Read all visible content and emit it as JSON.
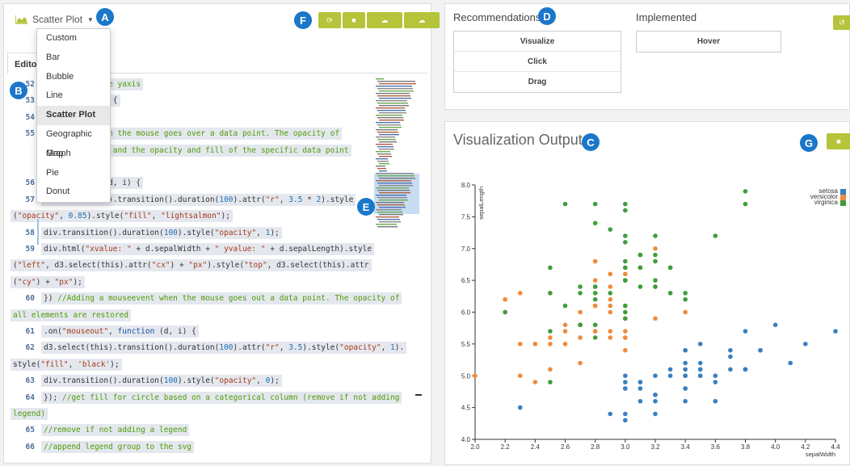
{
  "left": {
    "chart_type_selected": "Scatter Plot",
    "menu_items": [
      "Custom",
      "Bar",
      "Bubble",
      "Line",
      "Scatter Plot",
      "Geographic Map",
      "Graph",
      "Pie",
      "Donut"
    ],
    "active_menu_index": 4,
    "tab_label": "Edito",
    "toolbar_icons": [
      "refresh-icon",
      "save-icon",
      "cloud-upload-icon",
      "cloud-download-icon"
    ]
  },
  "badges": {
    "a": "A",
    "b": "B",
    "c": "C",
    "d": "D",
    "e": "E",
    "f": "F",
    "g": "G"
  },
  "code_lines": [
    {
      "n": "52",
      "parts": [
        {
          "t": "     position on the yaxis",
          "c": "cmt"
        }
      ]
    },
    {
      "n": "53",
      "parts": [
        {
          "t": "      , function (d) {",
          "c": ""
        }
      ]
    },
    {
      "n": "54",
      "parts": [
        {
          "t": "      r(d.species);",
          "c": ""
        }
      ]
    },
    {
      "n": "55",
      "parts": [
        {
          "t": "      mouseevent when the mouse goes over a data point. The opacity of",
          "c": "cmt"
        }
      ]
    },
    {
      "n": "",
      "parts": [
        {
          "t": "      nts is reduced and the opacity and fill of the specific data point",
          "c": "cmt"
        }
      ]
    },
    {
      "n": "",
      "parts": [
        {
          "t": "",
          "c": ""
        }
      ]
    },
    {
      "n": "56",
      "parts": [
        {
          "t": "      r\", function (d, i) {",
          "c": ""
        }
      ]
    },
    {
      "n": "57",
      "parts": [
        {
          "t": "  d3.select(this).transition().duration(",
          "c": ""
        },
        {
          "t": "100",
          "c": "num"
        },
        {
          "t": ").attr(",
          "c": ""
        },
        {
          "t": "\"r\"",
          "c": "str"
        },
        {
          "t": ", ",
          "c": ""
        },
        {
          "t": "3.5",
          "c": "num"
        },
        {
          "t": " * ",
          "c": ""
        },
        {
          "t": "2",
          "c": "num"
        },
        {
          "t": ").style",
          "c": ""
        }
      ]
    },
    {
      "n": "",
      "wrap": true,
      "parts": [
        {
          "t": "(",
          "c": ""
        },
        {
          "t": "\"opacity\"",
          "c": "str"
        },
        {
          "t": ", ",
          "c": ""
        },
        {
          "t": "0.85",
          "c": "num"
        },
        {
          "t": ").style(",
          "c": ""
        },
        {
          "t": "\"fill\"",
          "c": "str"
        },
        {
          "t": ", ",
          "c": ""
        },
        {
          "t": "\"lightsalmon\"",
          "c": "str"
        },
        {
          "t": ");",
          "c": ""
        }
      ]
    },
    {
      "n": "58",
      "parts": [
        {
          "t": "    div.transition().duration(",
          "c": ""
        },
        {
          "t": "100",
          "c": "num"
        },
        {
          "t": ").style(",
          "c": ""
        },
        {
          "t": "\"opacity\"",
          "c": "str"
        },
        {
          "t": ", ",
          "c": ""
        },
        {
          "t": "1",
          "c": "num"
        },
        {
          "t": ");",
          "c": ""
        }
      ]
    },
    {
      "n": "59",
      "parts": [
        {
          "t": "    div.html(",
          "c": ""
        },
        {
          "t": "\"xvalue: \"",
          "c": "str"
        },
        {
          "t": " + d.sepalWidth + ",
          "c": ""
        },
        {
          "t": "\" yvalue: \"",
          "c": "str"
        },
        {
          "t": " + d.sepalLength).style",
          "c": ""
        }
      ]
    },
    {
      "n": "",
      "wrap": true,
      "parts": [
        {
          "t": "(",
          "c": ""
        },
        {
          "t": "\"left\"",
          "c": "str"
        },
        {
          "t": ", d3.select(this).attr(",
          "c": ""
        },
        {
          "t": "\"cx\"",
          "c": "str"
        },
        {
          "t": ") + ",
          "c": ""
        },
        {
          "t": "\"px\"",
          "c": "str"
        },
        {
          "t": ").style(",
          "c": ""
        },
        {
          "t": "\"top\"",
          "c": "str"
        },
        {
          "t": ", d3.select(this).attr",
          "c": ""
        }
      ]
    },
    {
      "n": "",
      "wrap": true,
      "parts": [
        {
          "t": "(",
          "c": ""
        },
        {
          "t": "\"cy\"",
          "c": "str"
        },
        {
          "t": ") + ",
          "c": ""
        },
        {
          "t": "\"px\"",
          "c": "str"
        },
        {
          "t": ");",
          "c": ""
        }
      ]
    },
    {
      "n": "60",
      "parts": [
        {
          "t": "  }) ",
          "c": ""
        },
        {
          "t": "//Adding a mouseevent when the mouse goes out a data point. The opacity of",
          "c": "cmt"
        }
      ]
    },
    {
      "n": "",
      "wrap": true,
      "parts": [
        {
          "t": "all elements are restored",
          "c": "cmt"
        }
      ]
    },
    {
      "n": "61",
      "parts": [
        {
          "t": "  .on(",
          "c": ""
        },
        {
          "t": "\"mouseout\"",
          "c": "str"
        },
        {
          "t": ", ",
          "c": ""
        },
        {
          "t": "function",
          "c": "kw"
        },
        {
          "t": " (d, i) {",
          "c": ""
        }
      ]
    },
    {
      "n": "62",
      "parts": [
        {
          "t": "    d3.select(this).transition().duration(",
          "c": ""
        },
        {
          "t": "100",
          "c": "num"
        },
        {
          "t": ").attr(",
          "c": ""
        },
        {
          "t": "\"r\"",
          "c": "str"
        },
        {
          "t": ", ",
          "c": ""
        },
        {
          "t": "3.5",
          "c": "num"
        },
        {
          "t": ").style(",
          "c": ""
        },
        {
          "t": "\"opacity\"",
          "c": "str"
        },
        {
          "t": ", ",
          "c": ""
        },
        {
          "t": "1",
          "c": "num"
        },
        {
          "t": ").",
          "c": ""
        }
      ]
    },
    {
      "n": "",
      "wrap": true,
      "parts": [
        {
          "t": "style(",
          "c": ""
        },
        {
          "t": "\"fill\"",
          "c": "str"
        },
        {
          "t": ", ",
          "c": ""
        },
        {
          "t": "'black'",
          "c": "str"
        },
        {
          "t": ");",
          "c": ""
        }
      ]
    },
    {
      "n": "63",
      "parts": [
        {
          "t": "    div.transition().duration(",
          "c": ""
        },
        {
          "t": "100",
          "c": "num"
        },
        {
          "t": ").style(",
          "c": ""
        },
        {
          "t": "\"opacity\"",
          "c": "str"
        },
        {
          "t": ", ",
          "c": ""
        },
        {
          "t": "0",
          "c": "num"
        },
        {
          "t": ");",
          "c": ""
        }
      ]
    },
    {
      "n": "64",
      "parts": [
        {
          "t": "  }); ",
          "c": ""
        },
        {
          "t": "//get fill for circle based on a categorical column (remove if not adding",
          "c": "cmt"
        }
      ]
    },
    {
      "n": "",
      "wrap": true,
      "parts": [
        {
          "t": "legend)",
          "c": "cmt"
        }
      ]
    },
    {
      "n": "65",
      "parts": [
        {
          "t": "  //remove if not adding a legend",
          "c": "cmt"
        }
      ]
    },
    {
      "n": "66",
      "parts": [
        {
          "t": "  //append legend group to the svg",
          "c": "cmt"
        }
      ]
    }
  ],
  "recommendations": {
    "heading": "Recommendations",
    "items": [
      "Visualize",
      "Click",
      "Drag"
    ],
    "implemented_heading": "Implemented",
    "implemented_items": [
      "Hover"
    ]
  },
  "output": {
    "title": "Visualization Output"
  },
  "colors": {
    "accent": "#b5c43a",
    "badge": "#1a77c9",
    "setosa": "#3a7fc1",
    "versicolor": "#f08a3c",
    "virginica": "#3f9e3a"
  },
  "chart_data": {
    "type": "scatter",
    "xlabel": "sepalWidth",
    "ylabel": "sepalLength",
    "xlim": [
      2.0,
      4.4
    ],
    "ylim": [
      4.0,
      8.0
    ],
    "xticks": [
      "2.0",
      "2.2",
      "2.4",
      "2.6",
      "2.8",
      "3.0",
      "3.2",
      "3.4",
      "3.6",
      "3.8",
      "4.0",
      "4.2",
      "4.4"
    ],
    "yticks": [
      "4.0",
      "4.5",
      "5.0",
      "5.5",
      "6.0",
      "6.5",
      "7.0",
      "7.5",
      "8.0"
    ],
    "legend": "top-right",
    "series": [
      {
        "name": "setosa",
        "points": [
          [
            3.5,
            5.1
          ],
          [
            3.0,
            4.9
          ],
          [
            3.2,
            4.7
          ],
          [
            3.1,
            4.6
          ],
          [
            3.6,
            5.0
          ],
          [
            3.9,
            5.4
          ],
          [
            3.4,
            4.6
          ],
          [
            3.4,
            5.0
          ],
          [
            2.9,
            4.4
          ],
          [
            3.1,
            4.9
          ],
          [
            3.7,
            5.4
          ],
          [
            3.4,
            4.8
          ],
          [
            3.0,
            4.8
          ],
          [
            3.0,
            4.3
          ],
          [
            4.0,
            5.8
          ],
          [
            4.4,
            5.7
          ],
          [
            3.9,
            5.4
          ],
          [
            3.5,
            5.1
          ],
          [
            3.8,
            5.7
          ],
          [
            3.8,
            5.1
          ],
          [
            3.4,
            5.4
          ],
          [
            3.7,
            5.1
          ],
          [
            3.6,
            4.6
          ],
          [
            3.3,
            5.1
          ],
          [
            3.4,
            4.8
          ],
          [
            3.0,
            5.0
          ],
          [
            3.4,
            5.0
          ],
          [
            3.5,
            5.2
          ],
          [
            3.4,
            5.2
          ],
          [
            3.2,
            4.7
          ],
          [
            3.1,
            4.8
          ],
          [
            3.4,
            5.4
          ],
          [
            4.1,
            5.2
          ],
          [
            4.2,
            5.5
          ],
          [
            3.1,
            4.9
          ],
          [
            3.2,
            5.0
          ],
          [
            3.5,
            5.5
          ],
          [
            3.6,
            4.9
          ],
          [
            3.0,
            4.4
          ],
          [
            3.4,
            5.1
          ],
          [
            3.5,
            5.0
          ],
          [
            2.3,
            4.5
          ],
          [
            3.2,
            4.4
          ],
          [
            3.5,
            5.0
          ],
          [
            3.8,
            5.1
          ],
          [
            3.0,
            4.8
          ],
          [
            3.8,
            5.1
          ],
          [
            3.2,
            4.6
          ],
          [
            3.7,
            5.3
          ],
          [
            3.3,
            5.0
          ]
        ]
      },
      {
        "name": "versicolor",
        "points": [
          [
            3.2,
            7.0
          ],
          [
            3.2,
            6.4
          ],
          [
            3.1,
            6.9
          ],
          [
            2.3,
            5.5
          ],
          [
            2.8,
            6.5
          ],
          [
            2.8,
            5.7
          ],
          [
            3.3,
            6.3
          ],
          [
            2.4,
            4.9
          ],
          [
            2.9,
            6.6
          ],
          [
            2.7,
            5.2
          ],
          [
            2.0,
            5.0
          ],
          [
            3.0,
            5.9
          ],
          [
            2.2,
            6.0
          ],
          [
            2.9,
            6.1
          ],
          [
            2.9,
            5.6
          ],
          [
            3.1,
            6.7
          ],
          [
            3.0,
            5.6
          ],
          [
            2.7,
            5.8
          ],
          [
            2.2,
            6.2
          ],
          [
            2.5,
            5.6
          ],
          [
            3.2,
            5.9
          ],
          [
            2.8,
            6.1
          ],
          [
            2.5,
            6.3
          ],
          [
            2.8,
            6.1
          ],
          [
            2.9,
            6.4
          ],
          [
            3.0,
            6.6
          ],
          [
            2.8,
            6.8
          ],
          [
            3.0,
            6.7
          ],
          [
            2.9,
            6.0
          ],
          [
            2.6,
            5.7
          ],
          [
            2.4,
            5.5
          ],
          [
            2.4,
            5.5
          ],
          [
            2.7,
            5.8
          ],
          [
            2.7,
            6.0
          ],
          [
            3.0,
            5.4
          ],
          [
            3.4,
            6.0
          ],
          [
            3.1,
            6.7
          ],
          [
            2.3,
            6.3
          ],
          [
            3.0,
            5.6
          ],
          [
            2.5,
            5.5
          ],
          [
            2.6,
            5.5
          ],
          [
            3.0,
            6.1
          ],
          [
            2.6,
            5.8
          ],
          [
            2.3,
            5.0
          ],
          [
            2.7,
            5.6
          ],
          [
            3.0,
            5.7
          ],
          [
            2.9,
            5.7
          ],
          [
            2.9,
            6.2
          ],
          [
            2.5,
            5.1
          ],
          [
            2.8,
            5.7
          ]
        ]
      },
      {
        "name": "virginica",
        "points": [
          [
            3.3,
            6.3
          ],
          [
            2.7,
            5.8
          ],
          [
            3.0,
            7.1
          ],
          [
            2.9,
            6.3
          ],
          [
            3.0,
            6.5
          ],
          [
            3.0,
            7.6
          ],
          [
            2.5,
            4.9
          ],
          [
            2.9,
            7.3
          ],
          [
            2.5,
            6.7
          ],
          [
            3.6,
            7.2
          ],
          [
            3.2,
            6.5
          ],
          [
            2.7,
            6.4
          ],
          [
            3.0,
            6.8
          ],
          [
            2.5,
            5.7
          ],
          [
            2.8,
            5.8
          ],
          [
            3.2,
            6.4
          ],
          [
            3.0,
            6.5
          ],
          [
            3.8,
            7.7
          ],
          [
            2.6,
            7.7
          ],
          [
            2.2,
            6.0
          ],
          [
            3.2,
            6.9
          ],
          [
            2.8,
            5.6
          ],
          [
            2.8,
            7.7
          ],
          [
            2.7,
            6.3
          ],
          [
            3.3,
            6.7
          ],
          [
            3.2,
            7.2
          ],
          [
            2.8,
            6.2
          ],
          [
            3.0,
            6.1
          ],
          [
            2.8,
            6.4
          ],
          [
            3.0,
            7.2
          ],
          [
            2.8,
            7.4
          ],
          [
            3.8,
            7.9
          ],
          [
            2.8,
            6.4
          ],
          [
            2.8,
            6.3
          ],
          [
            2.6,
            6.1
          ],
          [
            3.0,
            7.7
          ],
          [
            3.4,
            6.3
          ],
          [
            3.1,
            6.4
          ],
          [
            3.0,
            6.0
          ],
          [
            3.1,
            6.9
          ],
          [
            3.1,
            6.7
          ],
          [
            3.1,
            6.9
          ],
          [
            2.7,
            5.8
          ],
          [
            3.2,
            6.8
          ],
          [
            3.3,
            6.7
          ],
          [
            3.0,
            6.7
          ],
          [
            2.5,
            6.3
          ],
          [
            3.0,
            6.5
          ],
          [
            3.4,
            6.2
          ],
          [
            3.0,
            5.9
          ]
        ]
      }
    ]
  }
}
